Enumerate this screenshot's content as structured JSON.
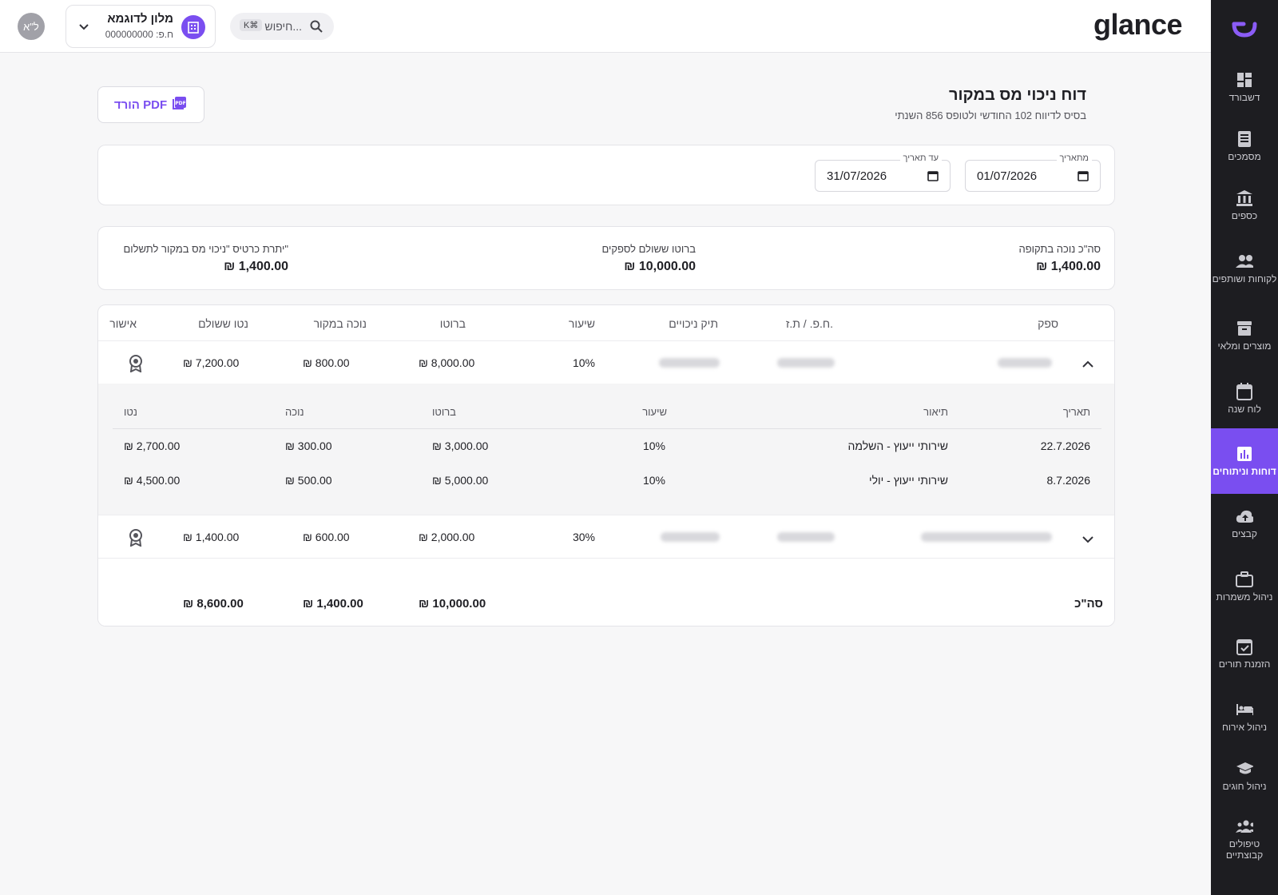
{
  "header": {
    "brand": "glance",
    "avatar_initials": "ל\"א",
    "business_name": "מלון לדוגמא",
    "business_number": "ח.פ: 000000000",
    "search_placeholder": "חיפוש...",
    "search_shortcut": "K⌘"
  },
  "sidebar": {
    "items": [
      {
        "label": "דשבורד",
        "icon": "dashboard-icon"
      },
      {
        "label": "מסמכים",
        "icon": "receipt-icon"
      },
      {
        "label": "כספים",
        "icon": "bank-icon"
      },
      {
        "label": "לקוחות ושותפים",
        "icon": "people-icon"
      },
      {
        "label": "מוצרים ומלאי",
        "icon": "archive-icon"
      },
      {
        "label": "לוח שנה",
        "icon": "calendar-icon"
      },
      {
        "label": "דוחות וניתוחים",
        "icon": "chart-icon",
        "active": true
      },
      {
        "label": "קבצים",
        "icon": "cloud-upload-icon"
      },
      {
        "label": "ניהול משמרות",
        "icon": "briefcase-icon"
      },
      {
        "label": "הזמנת תורים",
        "icon": "calendar-check-icon"
      },
      {
        "label": "ניהול אירוח",
        "icon": "bed-icon"
      },
      {
        "label": "ניהול חוגים",
        "icon": "graduation-icon"
      },
      {
        "label": "טיפולים קבוצתיים",
        "icon": "group-icon"
      }
    ]
  },
  "page": {
    "title": "דוח ניכוי מס במקור",
    "subtitle": "בסיס לדיווח 102 החודשי ולטופס 856 השנתי",
    "pdf_button": "הורד PDF"
  },
  "filters": {
    "from_label": "מתאריך",
    "from_value": "01/07/2026",
    "to_label": "עד תאריך",
    "to_value": "31/07/2026"
  },
  "summary": {
    "total_deducted_label": "סה\"כ נוכה בתקופה",
    "total_deducted_value": "₪ 1,400.00",
    "gross_paid_label": "ברוטו ששולם לספקים",
    "gross_paid_value": "₪ 10,000.00",
    "balance_label": "יתרת כרטיס \"ניכוי מס במקור לתשלום\"",
    "balance_value": "₪ 1,400.00"
  },
  "table": {
    "headers": {
      "supplier": "ספק",
      "company_id": "ח.פ. / ת.ז.",
      "deduction_file": "תיק ניכויים",
      "rate": "שיעור",
      "gross": "ברוטו",
      "deducted": "נוכה במקור",
      "net_paid": "נטו ששולם",
      "approval": "אישור"
    },
    "rows": [
      {
        "rate": "10%",
        "gross": "₪ 8,000.00",
        "deducted": "₪ 800.00",
        "net_paid": "₪ 7,200.00",
        "expanded": true
      },
      {
        "rate": "30%",
        "gross": "₪ 2,000.00",
        "deducted": "₪ 600.00",
        "net_paid": "₪ 1,400.00",
        "expanded": false
      }
    ],
    "sub_headers": {
      "date": "תאריך",
      "description": "תיאור",
      "rate": "שיעור",
      "gross": "ברוטו",
      "deducted": "נוכה",
      "net": "נטו"
    },
    "sub_rows": [
      {
        "date": "22.7.2026",
        "description": "שירותי ייעוץ - השלמה",
        "rate": "10%",
        "gross": "₪ 3,000.00",
        "deducted": "₪ 300.00",
        "net": "₪ 2,700.00"
      },
      {
        "date": "8.7.2026",
        "description": "שירותי ייעוץ - יולי",
        "rate": "10%",
        "gross": "₪ 5,000.00",
        "deducted": "₪ 500.00",
        "net": "₪ 4,500.00"
      }
    ],
    "totals": {
      "label": "סה\"כ",
      "gross": "₪ 10,000.00",
      "deducted": "₪ 1,400.00",
      "net_paid": "₪ 8,600.00"
    }
  },
  "colors": {
    "accent": "#7a4ef0",
    "sidebar_bg": "#1d1d21"
  }
}
